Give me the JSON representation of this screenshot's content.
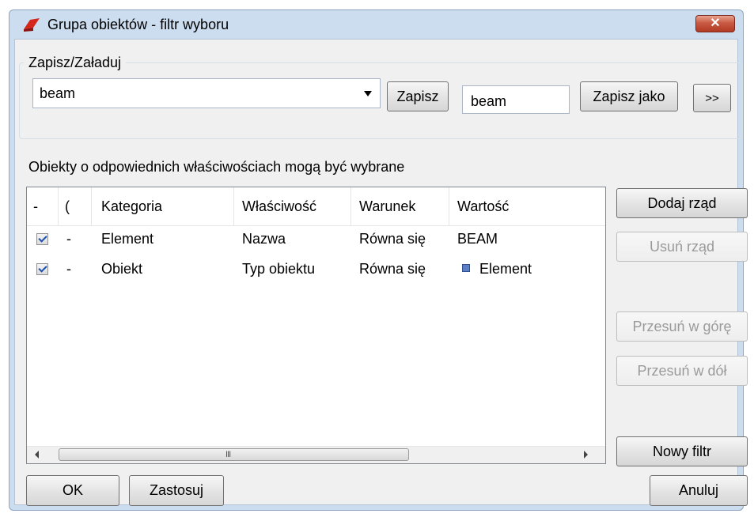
{
  "window": {
    "title": "Grupa obiektów - filtr wyboru",
    "close_label": "✕"
  },
  "save_load": {
    "group_label": "Zapisz/Załaduj",
    "combo_value": "beam",
    "save_label": "Zapisz",
    "name_value": "beam",
    "save_as_label": "Zapisz jako",
    "more_label": ">>"
  },
  "description": "Obiekty o odpowiednich właściwościach mogą być wybrane",
  "grid": {
    "columns": [
      "-",
      "(",
      "Kategoria",
      "Właściwość",
      "Warunek",
      "Wartość"
    ],
    "rows": [
      {
        "checked": true,
        "paren": "-",
        "category": "Element",
        "property": "Nazwa",
        "condition": "Równa się",
        "value": "BEAM",
        "value_icon": ""
      },
      {
        "checked": true,
        "paren": "-",
        "category": "Obiekt",
        "property": "Typ obiektu",
        "condition": "Równa się",
        "value": "Element",
        "value_icon": "blue-square-icon"
      }
    ],
    "scroll_grip": "III"
  },
  "side_buttons": {
    "add_row": "Dodaj rząd",
    "remove_row": "Usuń rząd",
    "move_up": "Przesuń w górę",
    "move_down": "Przesuń w dół",
    "new_filter": "Nowy filtr"
  },
  "bottom_buttons": {
    "ok": "OK",
    "apply": "Zastosuj",
    "cancel": "Anuluj"
  }
}
